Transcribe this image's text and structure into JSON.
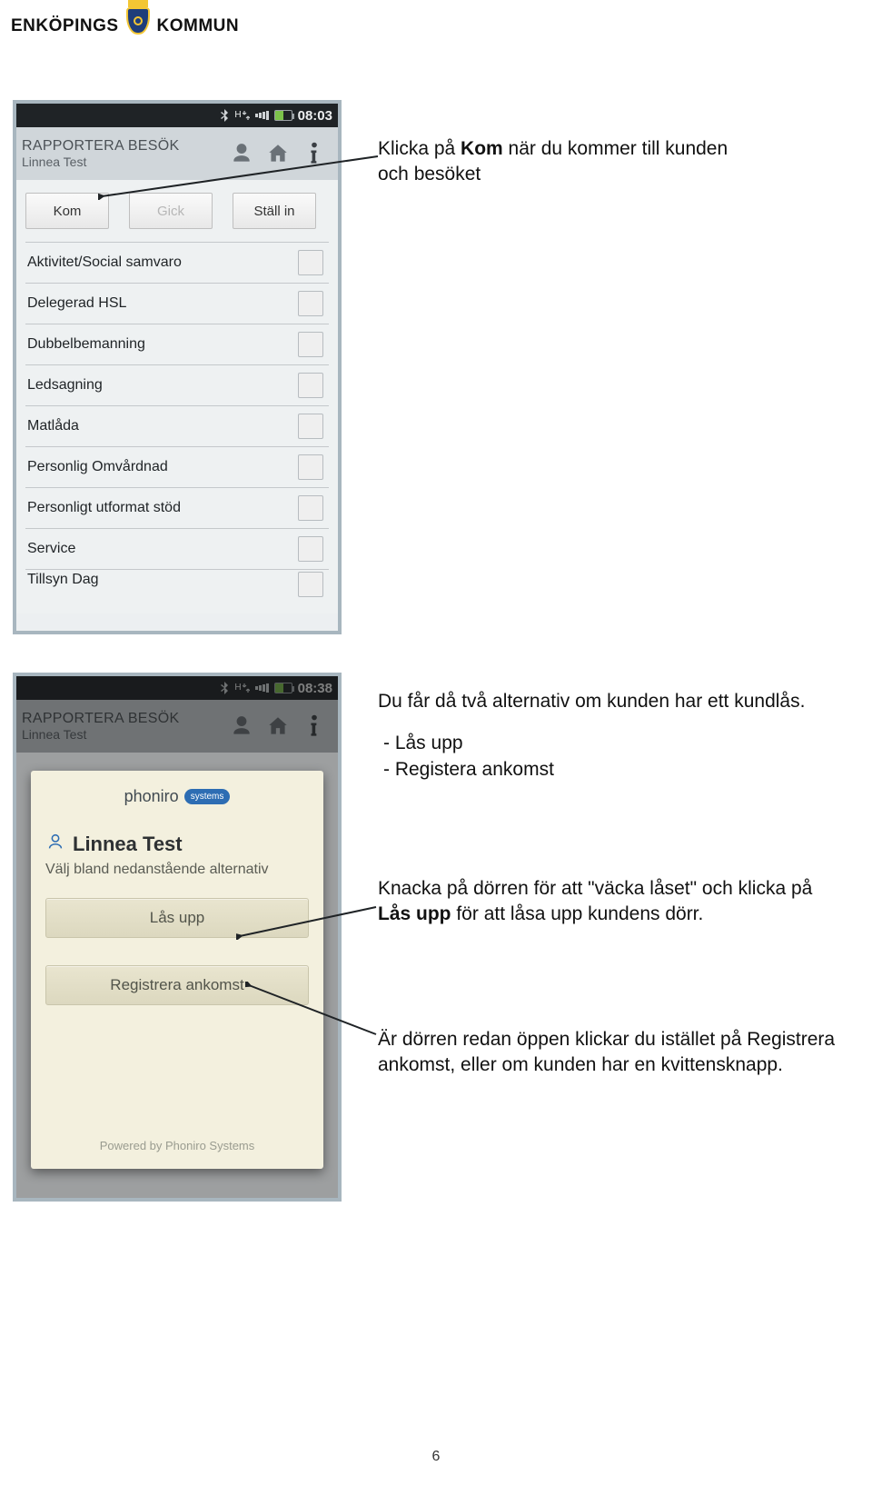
{
  "logo": {
    "left": "ENKÖPINGS",
    "right": "KOMMUN"
  },
  "phone1": {
    "status": {
      "h_label": "H",
      "clock": "08:03"
    },
    "appbar": {
      "title": "RAPPORTERA BESÖK",
      "subtitle": "Linnea Test"
    },
    "buttons": {
      "kom": "Kom",
      "gick": "Gick",
      "stallin": "Ställ in"
    },
    "options": [
      "Aktivitet/Social samvaro",
      "Delegerad HSL",
      "Dubbelbemanning",
      "Ledsagning",
      "Matlåda",
      "Personlig Omvårdnad",
      "Personligt utformat stöd",
      "Service"
    ],
    "clipped_option": "Tillsyn Dag"
  },
  "para1": {
    "pre": "Klicka på ",
    "bold": "Kom",
    "post": " när du kommer till kunden och besöket"
  },
  "phone2": {
    "status": {
      "h_label": "H",
      "clock": "08:38"
    },
    "appbar": {
      "title": "RAPPORTERA BESÖK",
      "subtitle": "Linnea Test"
    },
    "popup": {
      "brand_text": "phoniro",
      "brand_pill": "systems",
      "title": "Linnea Test",
      "subtitle": "Välj bland nedanstående alternativ",
      "btn_unlock": "Lås upp",
      "btn_register": "Registrera ankomst",
      "footer": "Powered by Phoniro Systems"
    }
  },
  "txtA": {
    "line": "Du får då två alternativ om kunden har ett kundlås.",
    "items": [
      "Lås upp",
      "Registera ankomst"
    ]
  },
  "txtB": {
    "pre": "Knacka på dörren för att \"väcka låset\" och klicka på ",
    "bold": "Lås upp",
    "post": " för att låsa upp kundens dörr."
  },
  "txtC": "Är dörren redan öppen klickar du istället på Registrera ankomst, eller om kunden har en kvittensknapp.",
  "page_number": "6"
}
